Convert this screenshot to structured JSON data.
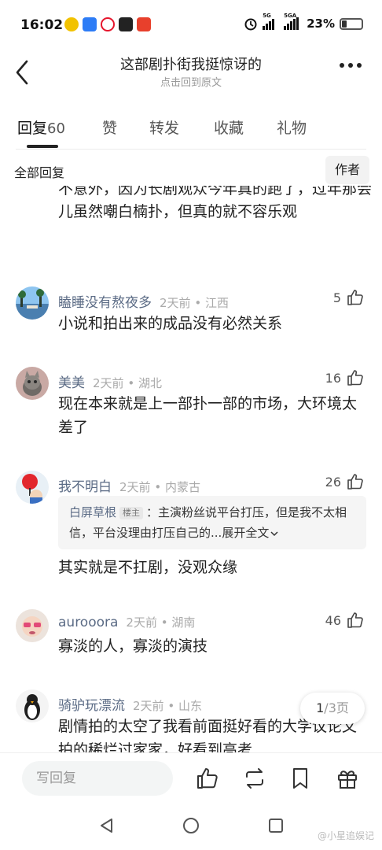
{
  "status_bar": {
    "time": "16:02",
    "battery": "23%",
    "signal_1": "5G",
    "signal_2": "5GA"
  },
  "header": {
    "title": "这部剧扑街我挺惊讶的",
    "subtitle": "点击回到原文"
  },
  "tabs": [
    {
      "label": "回复",
      "count": "60"
    },
    {
      "label": "赞"
    },
    {
      "label": "转发"
    },
    {
      "label": "收藏"
    },
    {
      "label": "礼物"
    }
  ],
  "filter": {
    "label": "全部回复",
    "author_button": "作者"
  },
  "partial_comment": {
    "text": "不意外，因为长剧观众今年真的跑了，过年那会儿虽然嘲白楠扑，但真的就不容乐观"
  },
  "comments": [
    {
      "name": "瞌睡没有熬夜多",
      "time": "2天前",
      "location": "江西",
      "likes": "5",
      "text": "小说和拍出来的成品没有必然关系"
    },
    {
      "name": "美美",
      "time": "2天前",
      "location": "湖北",
      "likes": "16",
      "text": "现在本来就是上一部扑一部的市场，大环境太差了"
    },
    {
      "name": "我不明白",
      "time": "2天前",
      "location": "内蒙古",
      "likes": "26",
      "reply": {
        "author": "白屏草根",
        "tag": "楼主",
        "text": "：主演粉丝说平台打压，但是我不太相信，平台没理由打压自己的...",
        "expand": "展开全文"
      },
      "text": "其实就是不扛剧，没观众缘"
    },
    {
      "name": "aurooora",
      "time": "2天前",
      "location": "湖南",
      "likes": "46",
      "text": "寡淡的人，寡淡的演技"
    },
    {
      "name": "骑驴玩漂流",
      "time": "2天前",
      "location": "山东",
      "text": "剧情拍的太空了我看前面挺好看的大学议论文拍的稀烂过家家，好看到高考"
    }
  ],
  "pagination": {
    "current": "1",
    "total": "/3页"
  },
  "bottom_bar": {
    "reply_placeholder": "写回复"
  },
  "watermark": "@小星追娱记"
}
